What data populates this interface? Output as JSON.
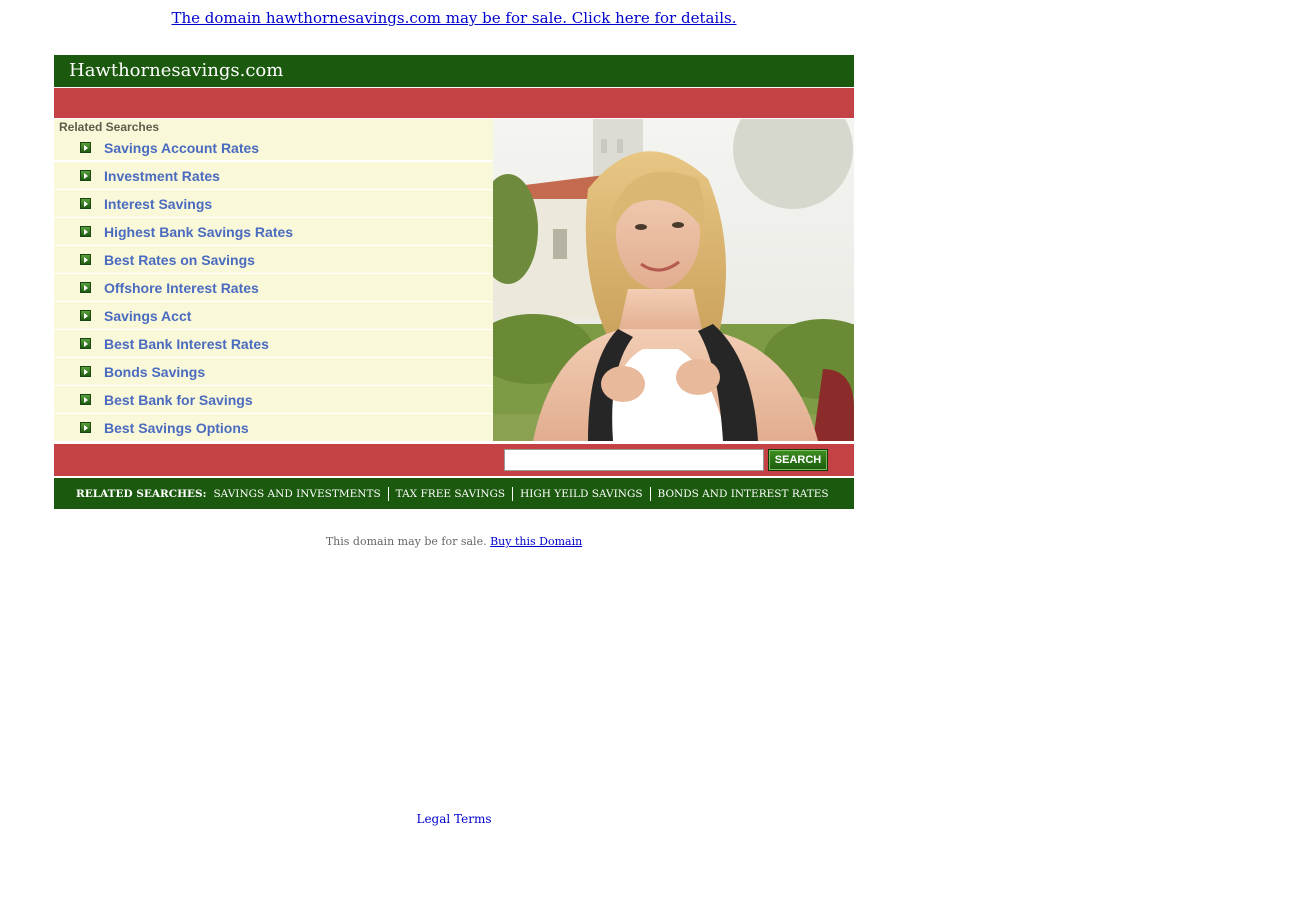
{
  "top_banner": {
    "text": "The domain hawthornesavings.com may be for sale. Click here for details."
  },
  "header": {
    "site_title": "Hawthornesavings.com"
  },
  "related_searches": {
    "heading": "Related Searches",
    "items": [
      {
        "label": "Savings Account Rates"
      },
      {
        "label": "Investment Rates"
      },
      {
        "label": "Interest Savings"
      },
      {
        "label": "Highest Bank Savings Rates"
      },
      {
        "label": "Best Rates on Savings"
      },
      {
        "label": "Offshore Interest Rates"
      },
      {
        "label": "Savings Acct"
      },
      {
        "label": "Best Bank Interest Rates"
      },
      {
        "label": "Bonds Savings"
      },
      {
        "label": "Best Bank for Savings"
      },
      {
        "label": "Best Savings Options"
      }
    ]
  },
  "search": {
    "input_value": "",
    "button_label": "SEARCH"
  },
  "bottom_related": {
    "label": "RELATED SEARCHES:",
    "items": [
      {
        "label": "SAVINGS AND INVESTMENTS"
      },
      {
        "label": "TAX FREE SAVINGS"
      },
      {
        "label": "HIGH YEILD SAVINGS"
      },
      {
        "label": "BONDS AND INTEREST RATES"
      }
    ]
  },
  "footer": {
    "for_sale_text": "This domain may be for sale.",
    "buy_link": "Buy this Domain",
    "legal_link": "Legal Terms"
  },
  "colors": {
    "dark_green": "#1b5a0e",
    "red_band": "#c44245",
    "cream_panel": "#f9f8d9",
    "link_blue": "#4a6bbf"
  }
}
